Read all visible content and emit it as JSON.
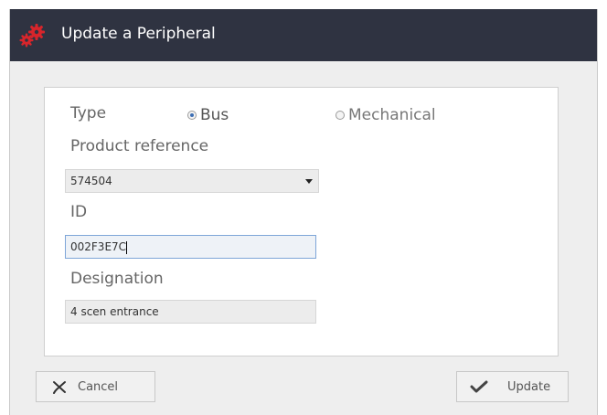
{
  "window": {
    "title": "Update a Peripheral"
  },
  "form": {
    "type_label": "Type",
    "type_options": [
      {
        "label": "Bus",
        "selected": true
      },
      {
        "label": "Mechanical",
        "selected": false
      }
    ],
    "product_reference_label": "Product reference",
    "product_reference_value": "574504",
    "id_label": "ID",
    "id_value": "002F3E7C",
    "designation_label": "Designation",
    "designation_value": "4 scen entrance"
  },
  "buttons": {
    "cancel_label": "Cancel",
    "update_label": "Update"
  },
  "icons": {
    "title": "gears-icon",
    "cancel": "x-icon",
    "update": "check-icon",
    "dropdown": "dropdown-arrow-icon"
  },
  "colors": {
    "titlebar": "#2f3341",
    "gear": "#d8252b",
    "radio_selected": "#3d6fb4"
  }
}
